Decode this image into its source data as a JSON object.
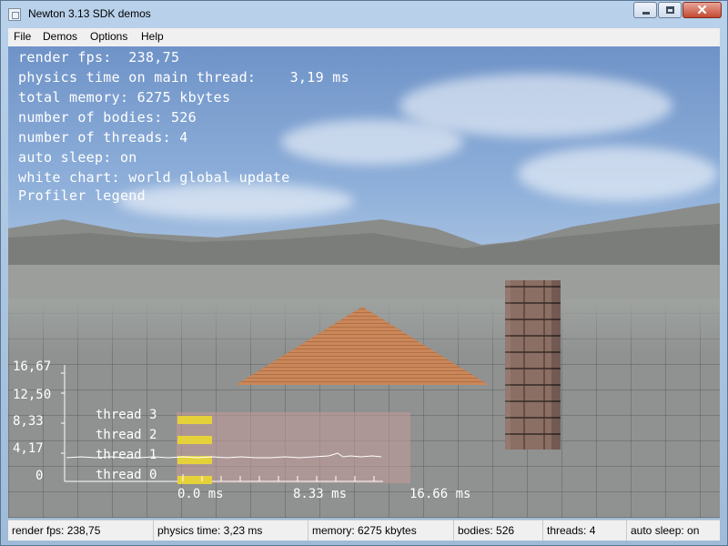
{
  "window": {
    "title": "Newton 3.13 SDK demos"
  },
  "menu": {
    "items": [
      "File",
      "Demos",
      "Options",
      "Help"
    ]
  },
  "hud": {
    "lines": [
      "render fps:  238,75",
      "physics time on main thread:    3,19 ms",
      "total memory: 6275 kbytes",
      "number of bodies: 526",
      "number of threads: 4",
      "auto sleep: on",
      "white chart: world global update",
      "Profiler legend"
    ]
  },
  "profiler": {
    "y_ticks": [
      "16,67",
      "12,50",
      "8,33",
      "4,17",
      "0"
    ],
    "thread_labels": [
      "thread 3",
      "thread 2",
      "thread 1",
      "thread 0"
    ],
    "x_ticks": [
      "0.0 ms",
      "8.33 ms",
      "16.66 ms"
    ],
    "legend_color": "#e5d23b",
    "panel_color": "#c79a9a",
    "line_color": "#ffffff"
  },
  "status": {
    "render_fps": "render fps:  238,75",
    "physics_time": "physics time: 3,23 ms",
    "memory": "memory: 6275 kbytes",
    "bodies": "bodies: 526",
    "threads": "threads: 4",
    "auto_sleep": "auto sleep: on"
  }
}
